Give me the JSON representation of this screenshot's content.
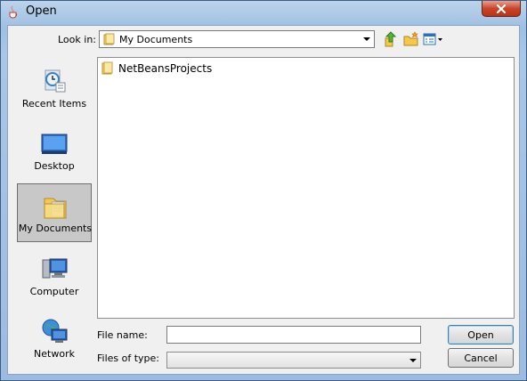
{
  "window": {
    "title": "Open",
    "icon": "java-cup-icon"
  },
  "look_in": {
    "label": "Look in:",
    "value": "My Documents"
  },
  "toolbar": {
    "buttons": [
      "up-one-level-icon",
      "create-new-folder-icon",
      "view-menu-icon"
    ]
  },
  "places": [
    {
      "label": "Recent Items",
      "icon": "recent-items-icon",
      "selected": false
    },
    {
      "label": "Desktop",
      "icon": "desktop-icon",
      "selected": false
    },
    {
      "label": "My Documents",
      "icon": "my-documents-icon",
      "selected": true
    },
    {
      "label": "Computer",
      "icon": "computer-icon",
      "selected": false
    },
    {
      "label": "Network",
      "icon": "network-icon",
      "selected": false
    }
  ],
  "files": [
    {
      "name": "NetBeansProjects",
      "icon": "folder-icon"
    }
  ],
  "file_name": {
    "label": "File name:",
    "value": ""
  },
  "file_type": {
    "label": "Files of type:",
    "value": ""
  },
  "buttons": {
    "open": "Open",
    "cancel": "Cancel"
  }
}
